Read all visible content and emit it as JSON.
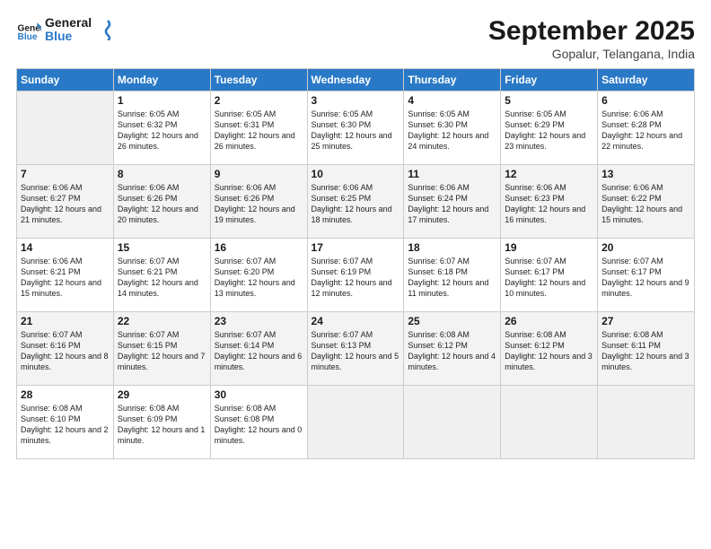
{
  "logo": {
    "line1": "General",
    "line2": "Blue"
  },
  "title": "September 2025",
  "subtitle": "Gopalur, Telangana, India",
  "days_header": [
    "Sunday",
    "Monday",
    "Tuesday",
    "Wednesday",
    "Thursday",
    "Friday",
    "Saturday"
  ],
  "weeks": [
    [
      {
        "num": "",
        "empty": true
      },
      {
        "num": "1",
        "sunrise": "6:05 AM",
        "sunset": "6:32 PM",
        "daylight": "12 hours and 26 minutes."
      },
      {
        "num": "2",
        "sunrise": "6:05 AM",
        "sunset": "6:31 PM",
        "daylight": "12 hours and 26 minutes."
      },
      {
        "num": "3",
        "sunrise": "6:05 AM",
        "sunset": "6:30 PM",
        "daylight": "12 hours and 25 minutes."
      },
      {
        "num": "4",
        "sunrise": "6:05 AM",
        "sunset": "6:30 PM",
        "daylight": "12 hours and 24 minutes."
      },
      {
        "num": "5",
        "sunrise": "6:05 AM",
        "sunset": "6:29 PM",
        "daylight": "12 hours and 23 minutes."
      },
      {
        "num": "6",
        "sunrise": "6:06 AM",
        "sunset": "6:28 PM",
        "daylight": "12 hours and 22 minutes."
      }
    ],
    [
      {
        "num": "7",
        "sunrise": "6:06 AM",
        "sunset": "6:27 PM",
        "daylight": "12 hours and 21 minutes."
      },
      {
        "num": "8",
        "sunrise": "6:06 AM",
        "sunset": "6:26 PM",
        "daylight": "12 hours and 20 minutes."
      },
      {
        "num": "9",
        "sunrise": "6:06 AM",
        "sunset": "6:26 PM",
        "daylight": "12 hours and 19 minutes."
      },
      {
        "num": "10",
        "sunrise": "6:06 AM",
        "sunset": "6:25 PM",
        "daylight": "12 hours and 18 minutes."
      },
      {
        "num": "11",
        "sunrise": "6:06 AM",
        "sunset": "6:24 PM",
        "daylight": "12 hours and 17 minutes."
      },
      {
        "num": "12",
        "sunrise": "6:06 AM",
        "sunset": "6:23 PM",
        "daylight": "12 hours and 16 minutes."
      },
      {
        "num": "13",
        "sunrise": "6:06 AM",
        "sunset": "6:22 PM",
        "daylight": "12 hours and 15 minutes."
      }
    ],
    [
      {
        "num": "14",
        "sunrise": "6:06 AM",
        "sunset": "6:21 PM",
        "daylight": "12 hours and 15 minutes."
      },
      {
        "num": "15",
        "sunrise": "6:07 AM",
        "sunset": "6:21 PM",
        "daylight": "12 hours and 14 minutes."
      },
      {
        "num": "16",
        "sunrise": "6:07 AM",
        "sunset": "6:20 PM",
        "daylight": "12 hours and 13 minutes."
      },
      {
        "num": "17",
        "sunrise": "6:07 AM",
        "sunset": "6:19 PM",
        "daylight": "12 hours and 12 minutes."
      },
      {
        "num": "18",
        "sunrise": "6:07 AM",
        "sunset": "6:18 PM",
        "daylight": "12 hours and 11 minutes."
      },
      {
        "num": "19",
        "sunrise": "6:07 AM",
        "sunset": "6:17 PM",
        "daylight": "12 hours and 10 minutes."
      },
      {
        "num": "20",
        "sunrise": "6:07 AM",
        "sunset": "6:17 PM",
        "daylight": "12 hours and 9 minutes."
      }
    ],
    [
      {
        "num": "21",
        "sunrise": "6:07 AM",
        "sunset": "6:16 PM",
        "daylight": "12 hours and 8 minutes."
      },
      {
        "num": "22",
        "sunrise": "6:07 AM",
        "sunset": "6:15 PM",
        "daylight": "12 hours and 7 minutes."
      },
      {
        "num": "23",
        "sunrise": "6:07 AM",
        "sunset": "6:14 PM",
        "daylight": "12 hours and 6 minutes."
      },
      {
        "num": "24",
        "sunrise": "6:07 AM",
        "sunset": "6:13 PM",
        "daylight": "12 hours and 5 minutes."
      },
      {
        "num": "25",
        "sunrise": "6:08 AM",
        "sunset": "6:12 PM",
        "daylight": "12 hours and 4 minutes."
      },
      {
        "num": "26",
        "sunrise": "6:08 AM",
        "sunset": "6:12 PM",
        "daylight": "12 hours and 3 minutes."
      },
      {
        "num": "27",
        "sunrise": "6:08 AM",
        "sunset": "6:11 PM",
        "daylight": "12 hours and 3 minutes."
      }
    ],
    [
      {
        "num": "28",
        "sunrise": "6:08 AM",
        "sunset": "6:10 PM",
        "daylight": "12 hours and 2 minutes."
      },
      {
        "num": "29",
        "sunrise": "6:08 AM",
        "sunset": "6:09 PM",
        "daylight": "12 hours and 1 minute."
      },
      {
        "num": "30",
        "sunrise": "6:08 AM",
        "sunset": "6:08 PM",
        "daylight": "12 hours and 0 minutes."
      },
      {
        "num": "",
        "empty": true
      },
      {
        "num": "",
        "empty": true
      },
      {
        "num": "",
        "empty": true
      },
      {
        "num": "",
        "empty": true
      }
    ]
  ]
}
